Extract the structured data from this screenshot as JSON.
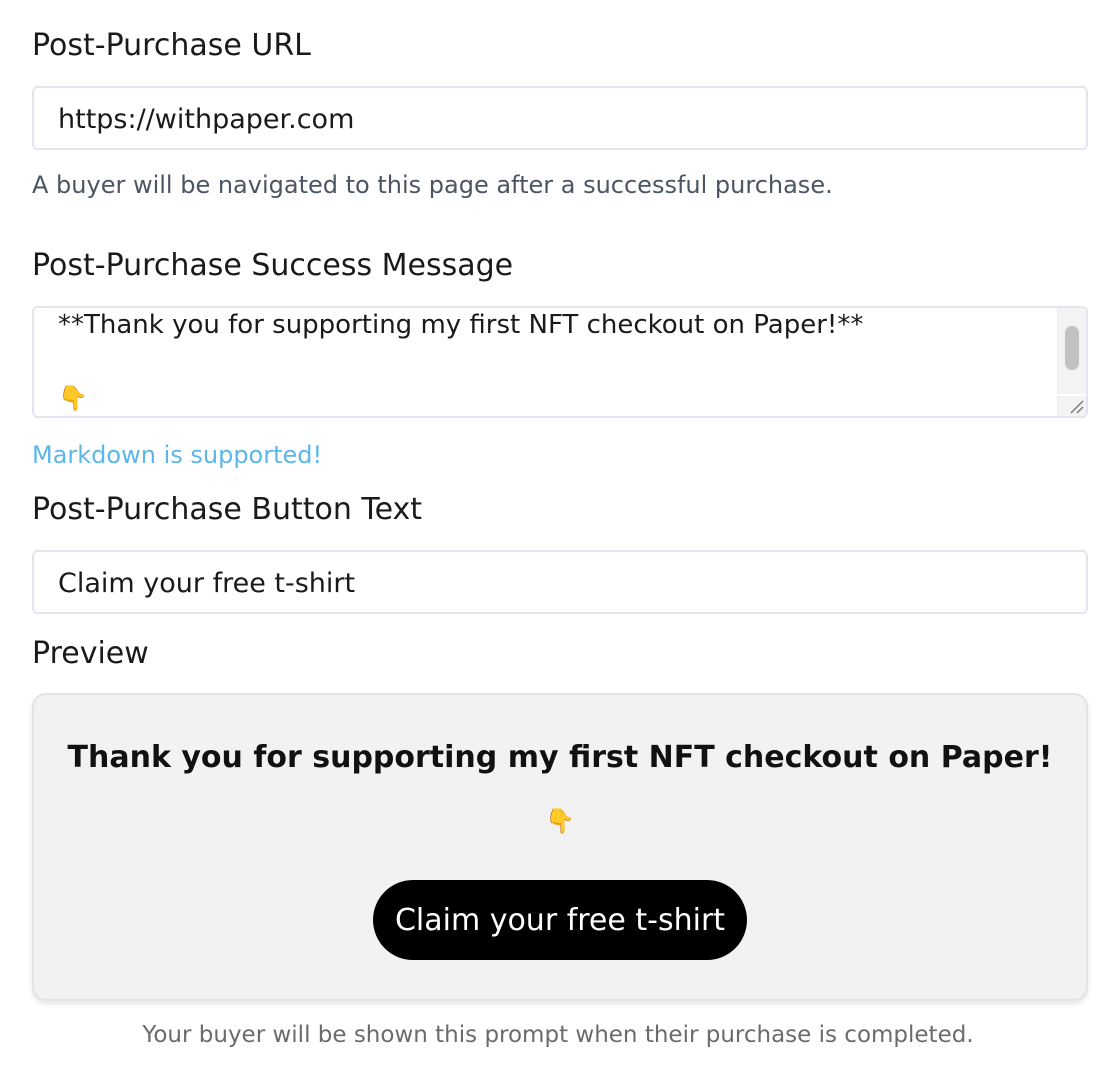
{
  "url_section": {
    "label": "Post-Purchase URL",
    "value": "https://withpaper.com",
    "help": "A buyer will be navigated to this page after a successful purchase."
  },
  "message_section": {
    "label": "Post-Purchase Success Message",
    "line1": "**Thank you for supporting my first NFT checkout on Paper!**",
    "line2_emoji": "👇",
    "help": "Markdown is supported!"
  },
  "button_section": {
    "label": "Post-Purchase Button Text",
    "value": "Claim your free t-shirt"
  },
  "preview": {
    "label": "Preview",
    "heading": "Thank you for supporting my first NFT checkout on Paper!",
    "emoji": "👇",
    "button_label": "Claim your free t-shirt",
    "footnote": "Your buyer will be shown this prompt when their purchase is completed."
  },
  "colors": {
    "link": "#5bb6ea",
    "button_bg": "#000000",
    "preview_bg": "#f2f2f2"
  }
}
